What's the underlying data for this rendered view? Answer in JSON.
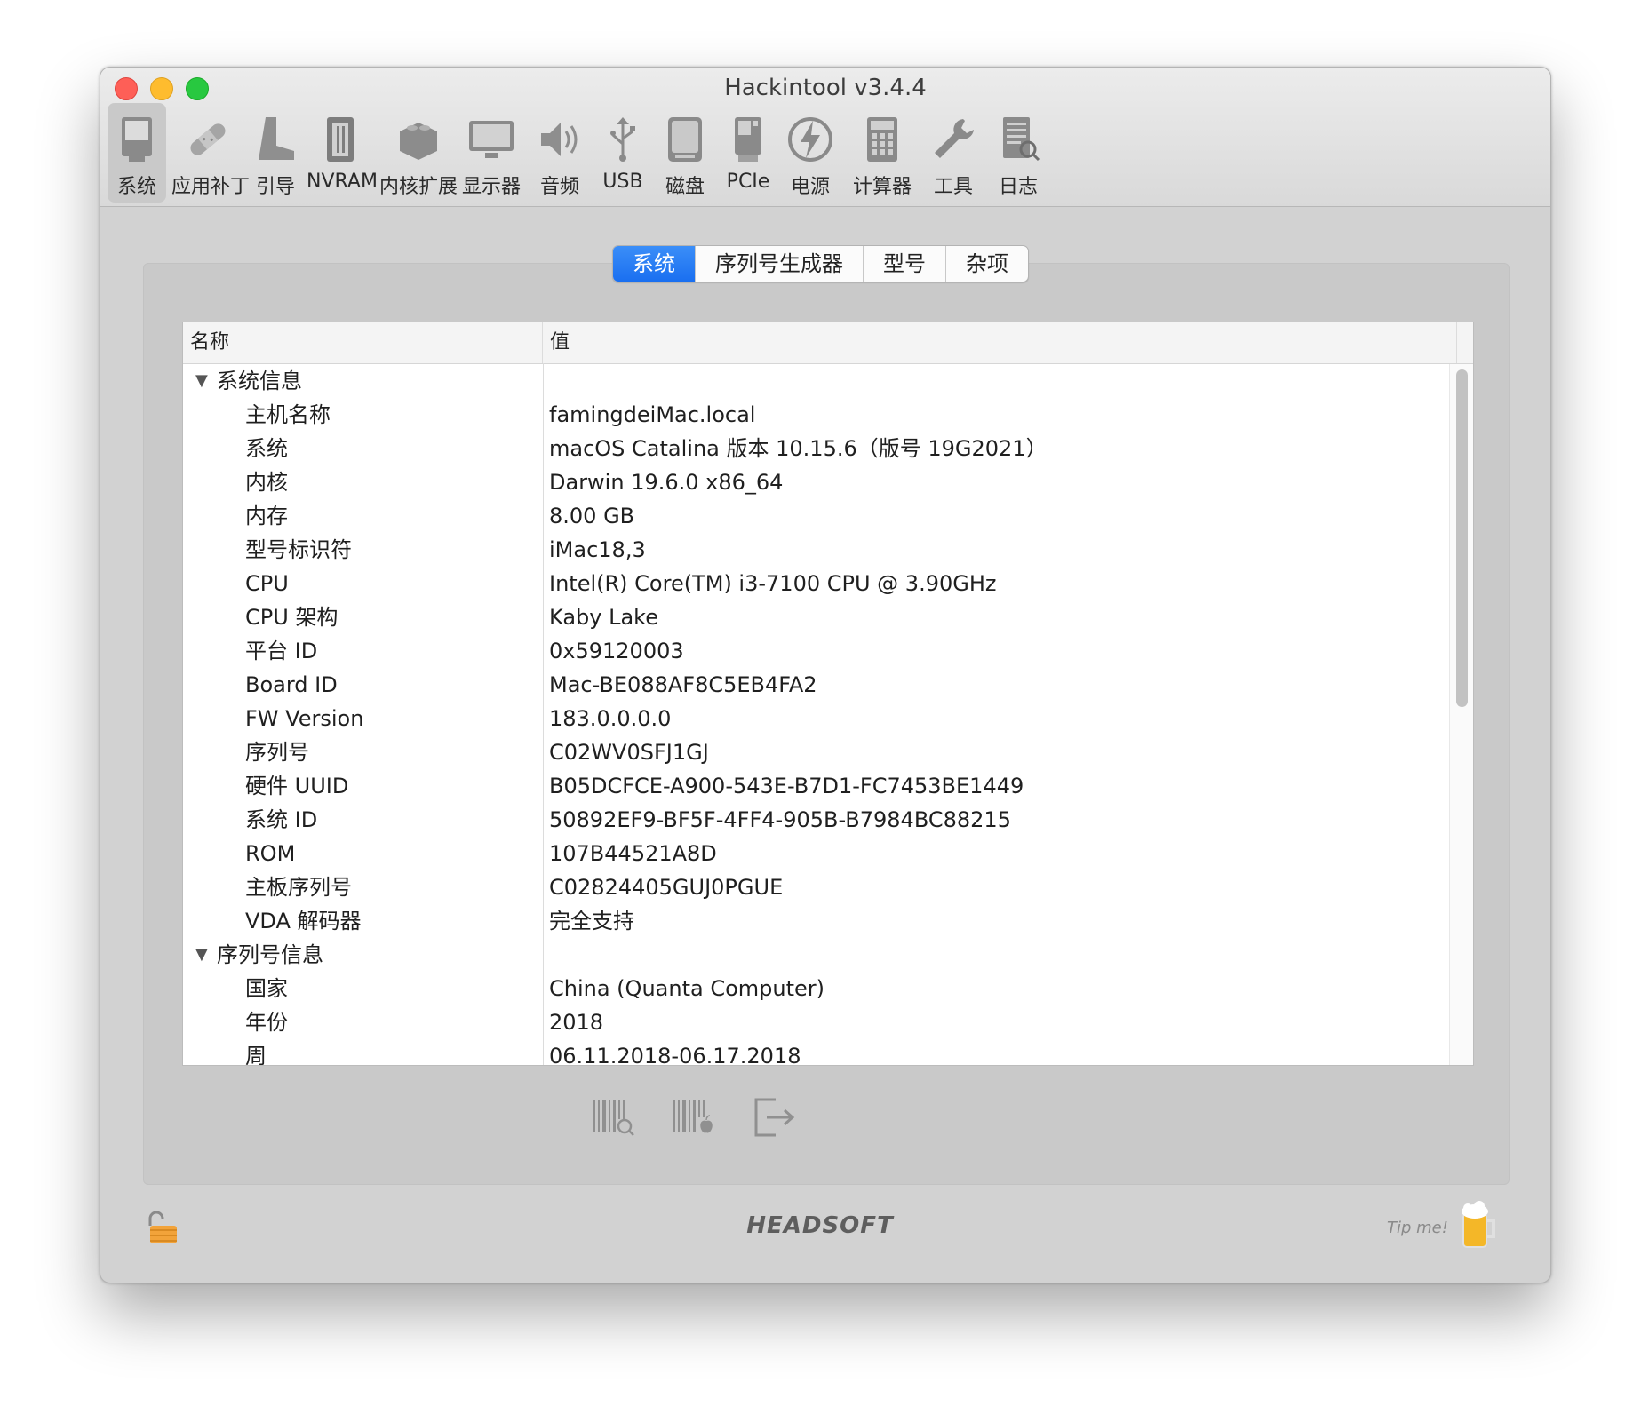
{
  "window": {
    "title": "Hackintool v3.4.4"
  },
  "toolbar": {
    "items": [
      {
        "label": "系统",
        "icon": "imac-icon",
        "active": true
      },
      {
        "label": "应用补丁",
        "icon": "bandage-icon"
      },
      {
        "label": "引导",
        "icon": "boot-icon"
      },
      {
        "label": "NVRAM",
        "icon": "nvram-chip-icon"
      },
      {
        "label": "内核扩展",
        "icon": "lego-brick-icon"
      },
      {
        "label": "显示器",
        "icon": "monitor-icon"
      },
      {
        "label": "音频",
        "icon": "speaker-icon"
      },
      {
        "label": "USB",
        "icon": "usb-icon"
      },
      {
        "label": "磁盘",
        "icon": "disk-icon"
      },
      {
        "label": "PCIe",
        "icon": "pcie-card-icon"
      },
      {
        "label": "电源",
        "icon": "power-lightning-icon"
      },
      {
        "label": "计算器",
        "icon": "calculator-icon"
      },
      {
        "label": "工具",
        "icon": "wrench-icon"
      },
      {
        "label": "日志",
        "icon": "log-document-icon"
      }
    ]
  },
  "tabs": [
    {
      "label": "系统",
      "active": true
    },
    {
      "label": "序列号生成器"
    },
    {
      "label": "型号"
    },
    {
      "label": "杂项"
    }
  ],
  "table": {
    "columns": {
      "name": "名称",
      "value": "值"
    },
    "rows": [
      {
        "name": "系统信息",
        "value": "",
        "group": true
      },
      {
        "name": "主机名称",
        "value": "famingdeiMac.local"
      },
      {
        "name": "系统",
        "value": "macOS Catalina 版本 10.15.6（版号 19G2021）"
      },
      {
        "name": "内核",
        "value": "Darwin 19.6.0 x86_64"
      },
      {
        "name": "内存",
        "value": "8.00 GB"
      },
      {
        "name": "型号标识符",
        "value": "iMac18,3"
      },
      {
        "name": "CPU",
        "value": "Intel(R) Core(TM) i3-7100 CPU @ 3.90GHz"
      },
      {
        "name": "CPU 架构",
        "value": "Kaby Lake"
      },
      {
        "name": "平台 ID",
        "value": "0x59120003"
      },
      {
        "name": "Board ID",
        "value": "Mac-BE088AF8C5EB4FA2"
      },
      {
        "name": "FW Version",
        "value": "183.0.0.0.0"
      },
      {
        "name": "序列号",
        "value": "C02WV0SFJ1GJ"
      },
      {
        "name": "硬件 UUID",
        "value": "B05DCFCE-A900-543E-B7D1-FC7453BE1449"
      },
      {
        "name": "系统 ID",
        "value": "50892EF9-BF5F-4FF4-905B-B7984BC88215"
      },
      {
        "name": "ROM",
        "value": "107B44521A8D"
      },
      {
        "name": "主板序列号",
        "value": "C02824405GUJ0PGUE"
      },
      {
        "name": "VDA 解码器",
        "value": "完全支持"
      },
      {
        "name": "序列号信息",
        "value": "",
        "group": true
      },
      {
        "name": "国家",
        "value": "China (Quanta Computer)"
      },
      {
        "name": "年份",
        "value": "2018"
      },
      {
        "name": "周",
        "value": "06.11.2018-06.17.2018"
      }
    ]
  },
  "bottom_actions": [
    {
      "icon": "barcode-search-icon"
    },
    {
      "icon": "barcode-apple-icon"
    },
    {
      "icon": "export-icon"
    }
  ],
  "footer": {
    "lock_icon": "unlocked-padlock-icon",
    "brand": "HEADSOFT",
    "tip": "Tip me!",
    "tip_icon": "beer-mug-icon"
  },
  "colors": {
    "accent": "#1a6ff0",
    "close": "#fe5f57",
    "minimize": "#febc2e",
    "maximize": "#28c840"
  }
}
